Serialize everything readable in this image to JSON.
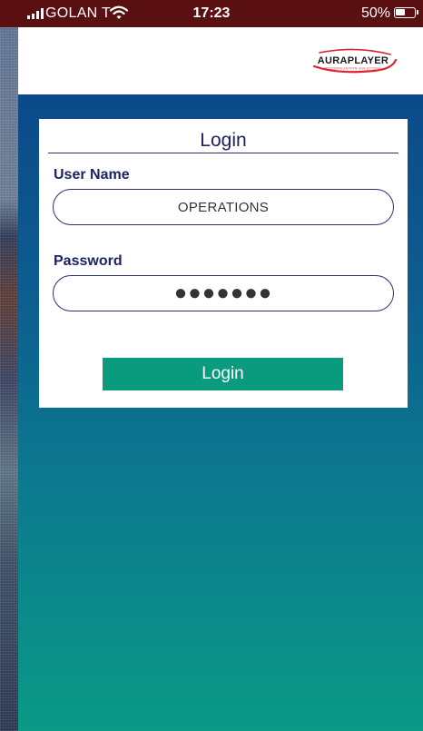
{
  "status_bar": {
    "carrier": "GOLAN T",
    "time": "17:23",
    "battery_percent": "50%",
    "icons": [
      "signal-icon",
      "wifi-icon",
      "battery-icon"
    ]
  },
  "header": {
    "logo_text": "AURAPLAYER",
    "logo_tagline": "MODERNIZATION SOLUTIONS"
  },
  "login": {
    "title": "Login",
    "username_label": "User Name",
    "username_value": "OPERATIONS",
    "password_label": "Password",
    "password_value": "●●●●●●●",
    "button_label": "Login"
  },
  "colors": {
    "status_bar_bg": "#5a0f10",
    "primary_text": "#1c2262",
    "button_bg": "#0a9a7e",
    "gradient_top": "#0c4a8a",
    "gradient_bottom": "#0a9a86",
    "logo_accent": "#d8262e"
  }
}
